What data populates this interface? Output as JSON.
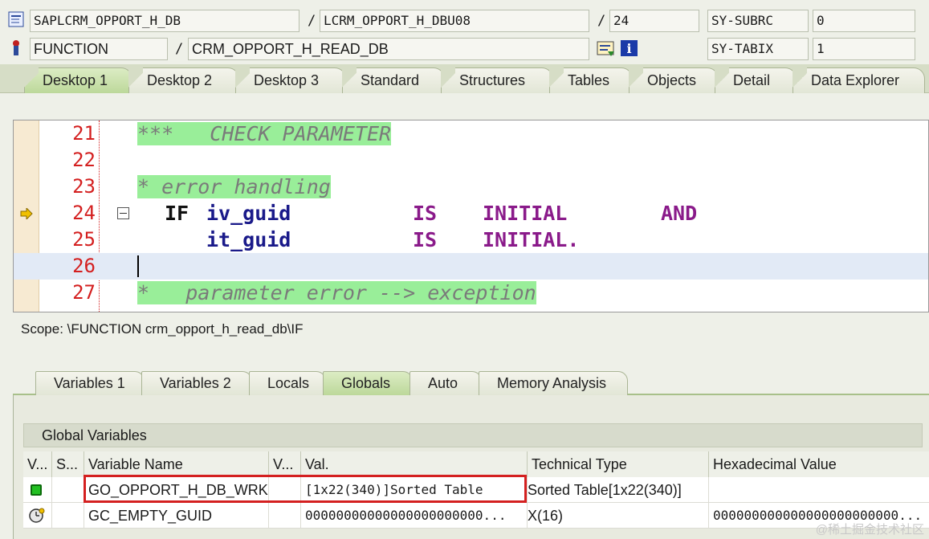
{
  "header": {
    "program": "SAPLCRM_OPPORT_H_DB",
    "include": "LCRM_OPPORT_H_DBU08",
    "line_no": "24",
    "sysfield1_name": "SY-SUBRC",
    "sysfield1_value": "0",
    "event_type": "FUNCTION",
    "event_name": "CRM_OPPORT_H_READ_DB",
    "sysfield2_name": "SY-TABIX",
    "sysfield2_value": "1",
    "slash": "/"
  },
  "tabs": [
    "Desktop 1",
    "Desktop 2",
    "Desktop 3",
    "Standard",
    "Structures",
    "Tables",
    "Objects",
    "Detail",
    "Data Explorer"
  ],
  "code": {
    "line_numbers": [
      "21",
      "22",
      "23",
      "24",
      "25",
      "26",
      "27"
    ],
    "l21": "***   CHECK PARAMETER",
    "l23": "* error handling",
    "l24_if": "IF",
    "l24_var": "iv_guid",
    "l24_is": "IS",
    "l24_initial": "INITIAL",
    "l24_and": "AND",
    "l25_var": "it_guid",
    "l25_is": "IS",
    "l25_initial": "INITIAL.",
    "l27": "*   parameter error --> exception"
  },
  "scope": "Scope: \\FUNCTION crm_opport_h_read_db\\IF",
  "var_tabs": [
    "Variables 1",
    "Variables 2",
    "Locals",
    "Globals",
    "Auto",
    "Memory Analysis"
  ],
  "globals": {
    "title": "Global Variables",
    "columns": [
      "V...",
      "S...",
      "Variable Name",
      "V...",
      "Val.",
      "Technical Type",
      "Hexadecimal Value"
    ],
    "rows": [
      {
        "name": "GO_OPPORT_H_DB_WRK",
        "val": "[1x22(340)]Sorted Table",
        "type": "Sorted Table[1x22(340)]",
        "hex": ""
      },
      {
        "name": "GC_EMPTY_GUID",
        "val": "00000000000000000000000...",
        "type": "X(16)",
        "hex": "000000000000000000000000..."
      }
    ]
  },
  "watermark": "@稀土掘金技术社区",
  "colors": {
    "line_number": "#d42020",
    "comment_bg": "#99ee99",
    "keyword": "#8a1a8a",
    "highlight_box": "#d42020"
  }
}
